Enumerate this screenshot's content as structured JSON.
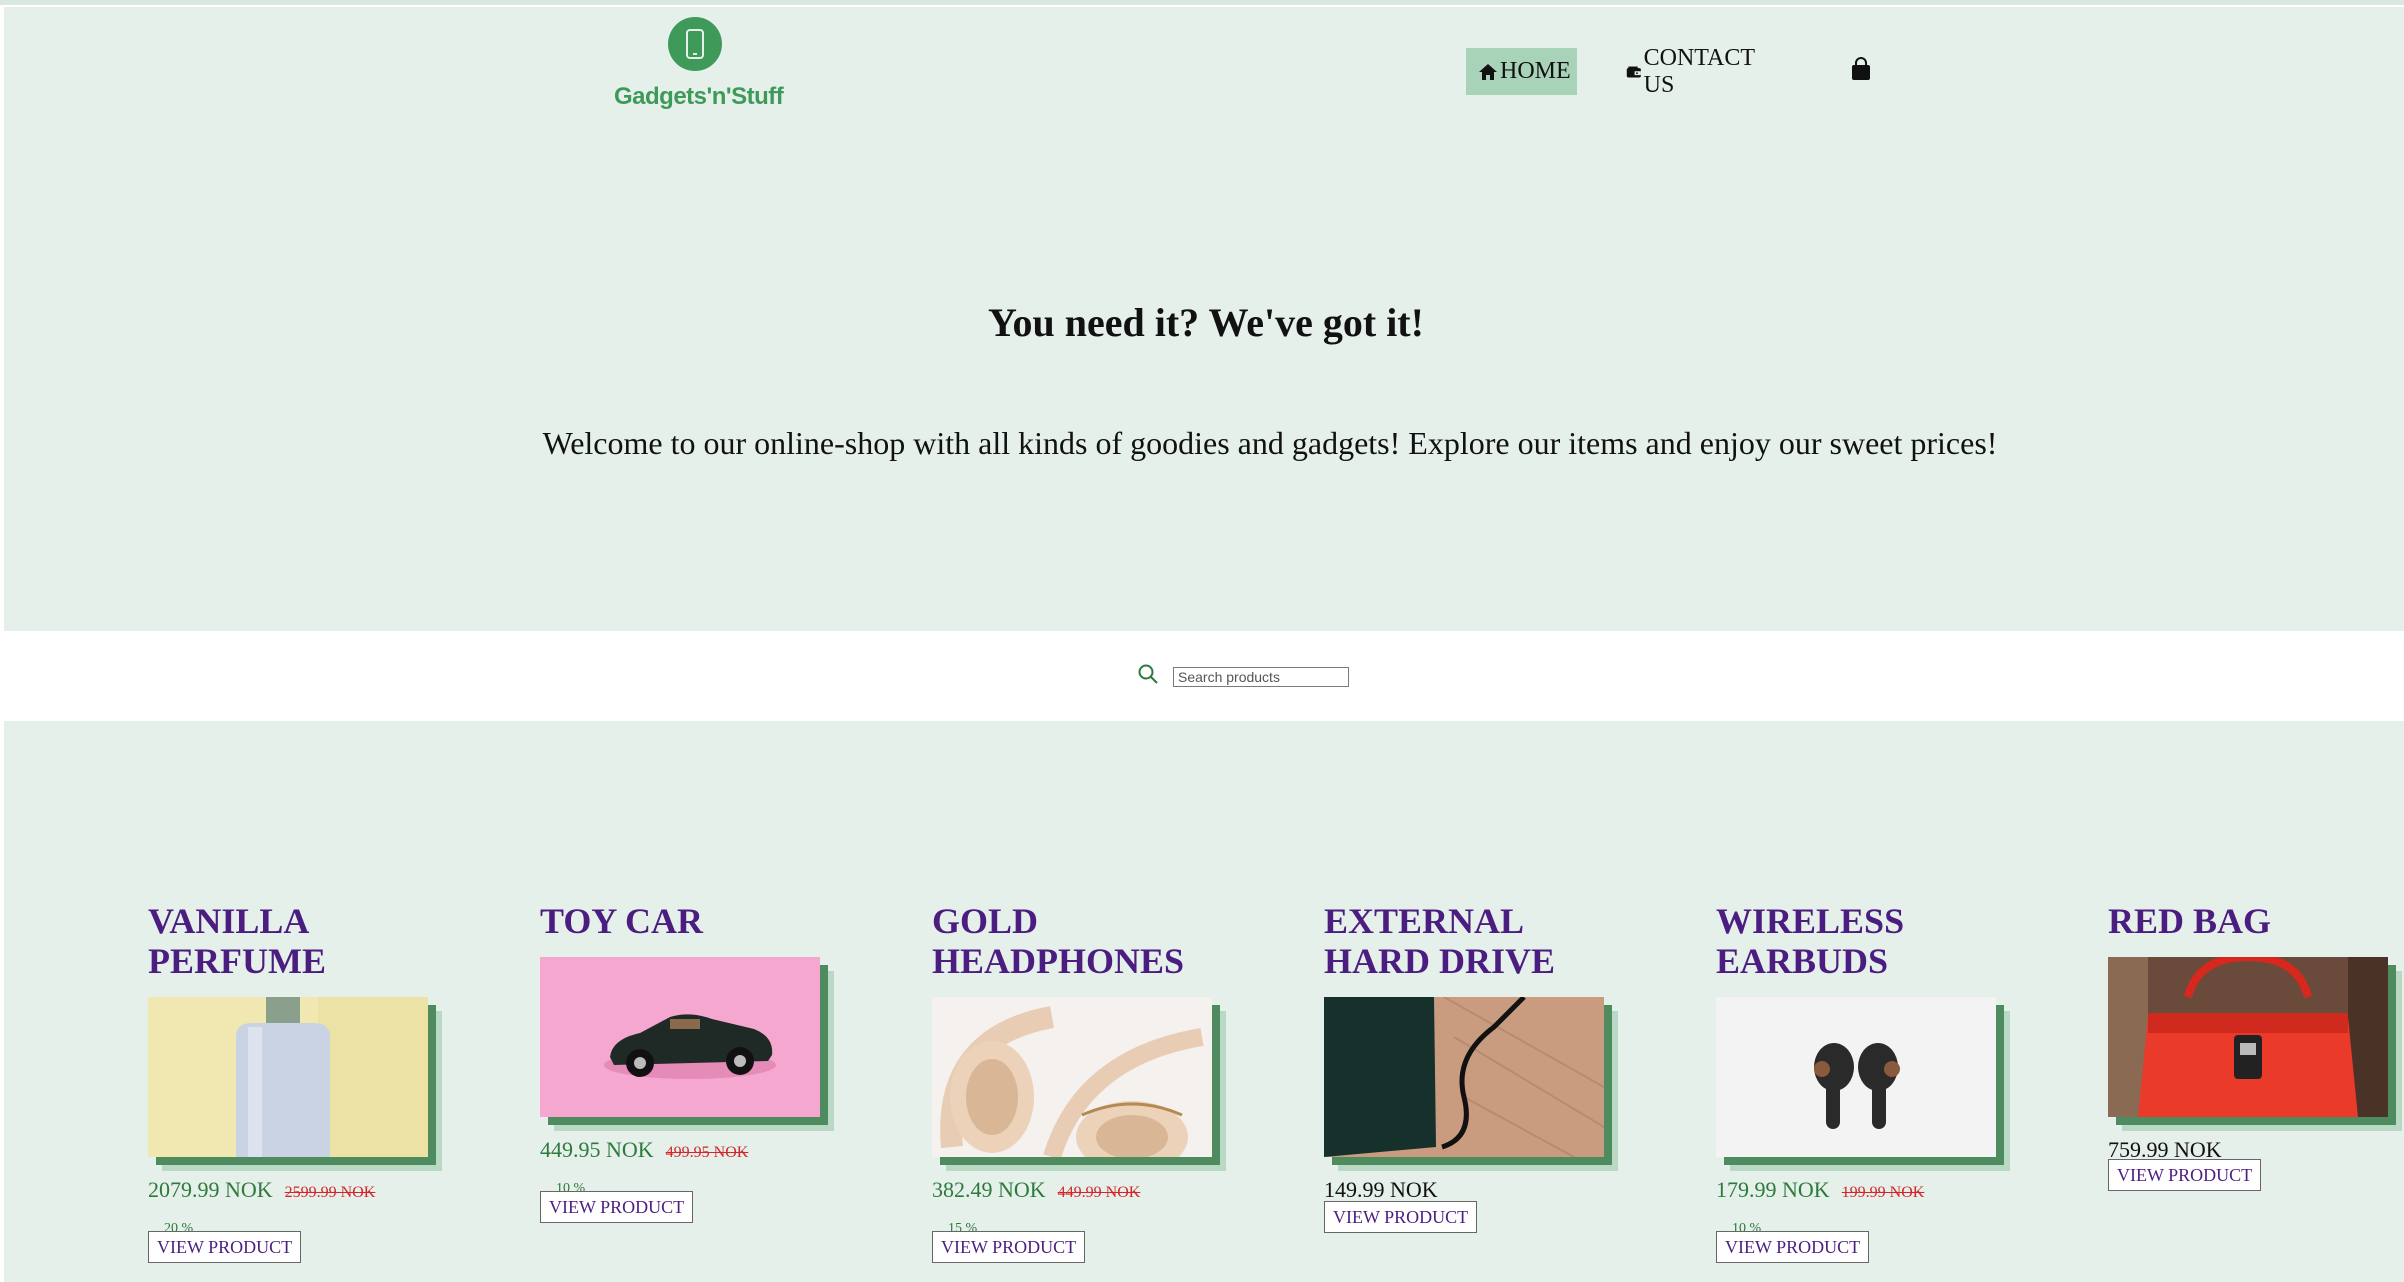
{
  "brand": {
    "name": "Gadgets'n'Stuff",
    "color": "#3f9a5a"
  },
  "nav": {
    "home": "HOME",
    "contact": "CONTACT US",
    "active_color": "#a9d3b9",
    "icons": [
      "home-icon",
      "wallet-icon",
      "shopping-bag-icon"
    ]
  },
  "hero": {
    "title": "You need it? We've got it!",
    "subtitle": "Welcome to our online-shop with all kinds of goodies and gadgets! Explore our items and enjoy our sweet prices!",
    "background": "#e5f0ea"
  },
  "search": {
    "placeholder": "Search products",
    "icon": "search-icon"
  },
  "products": [
    {
      "name": "Vanilla Perfume",
      "price": "2079.99 NOK",
      "old_price": "2599.99 NOK",
      "discount": "20 %",
      "button": "VIEW PRODUCT"
    },
    {
      "name": "Toy Car",
      "price": "449.95 NOK",
      "old_price": "499.95 NOK",
      "discount": "10 %",
      "button": "VIEW PRODUCT"
    },
    {
      "name": "Gold Headphones",
      "price": "382.49 NOK",
      "old_price": "449.99 NOK",
      "discount": "15 %",
      "button": "VIEW PRODUCT"
    },
    {
      "name": "External Hard Drive",
      "price": "149.99 NOK",
      "old_price": "",
      "discount": "",
      "button": "VIEW PRODUCT"
    },
    {
      "name": "Wireless Earbuds",
      "price": "179.99 NOK",
      "old_price": "199.99 NOK",
      "discount": "10 %",
      "button": "VIEW PRODUCT"
    },
    {
      "name": "Red Bag",
      "price": "759.99 NOK",
      "old_price": "",
      "discount": "",
      "button": "VIEW PRODUCT"
    }
  ],
  "colors": {
    "product_title": "#4c1d80",
    "price": "#2d7a3c",
    "old_price": "#d4262a"
  }
}
